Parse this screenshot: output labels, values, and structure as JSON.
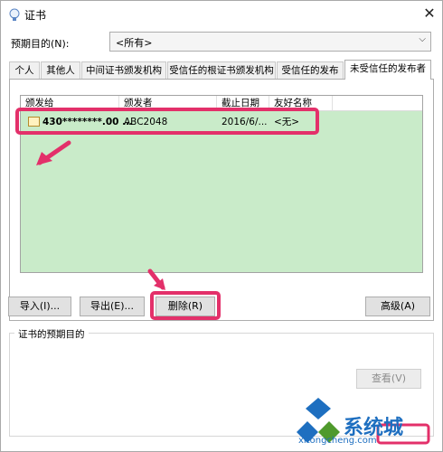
{
  "window": {
    "title": "证书",
    "close_glyph": "✕"
  },
  "purpose": {
    "label": "预期目的(N):",
    "selected": "<所有>"
  },
  "tabs": [
    {
      "label": "个人"
    },
    {
      "label": "其他人"
    },
    {
      "label": "中间证书颁发机构"
    },
    {
      "label": "受信任的根证书颁发机构"
    },
    {
      "label": "受信任的发布者"
    },
    {
      "label": "未受信任的发布者"
    }
  ],
  "list": {
    "headers": [
      "颁发给",
      "颁发者",
      "截止日期",
      "友好名称"
    ],
    "rows": [
      {
        "issued_to": "430********.00 ...",
        "issuer": "ABC2048",
        "expires": "2016/6/...",
        "friendly": "<无>"
      }
    ]
  },
  "buttons": {
    "import": "导入(I)...",
    "export": "导出(E)...",
    "delete": "删除(R)",
    "advanced": "高级(A)",
    "view": "查看(V)"
  },
  "groupbox": {
    "title": "证书的预期目的"
  },
  "watermark": {
    "name": "系统城",
    "url": "xitongcheng.com"
  },
  "colors": {
    "highlight": "#e3306a",
    "selected_row": "#c9ebc9",
    "watermark": "#1e6fc0"
  }
}
